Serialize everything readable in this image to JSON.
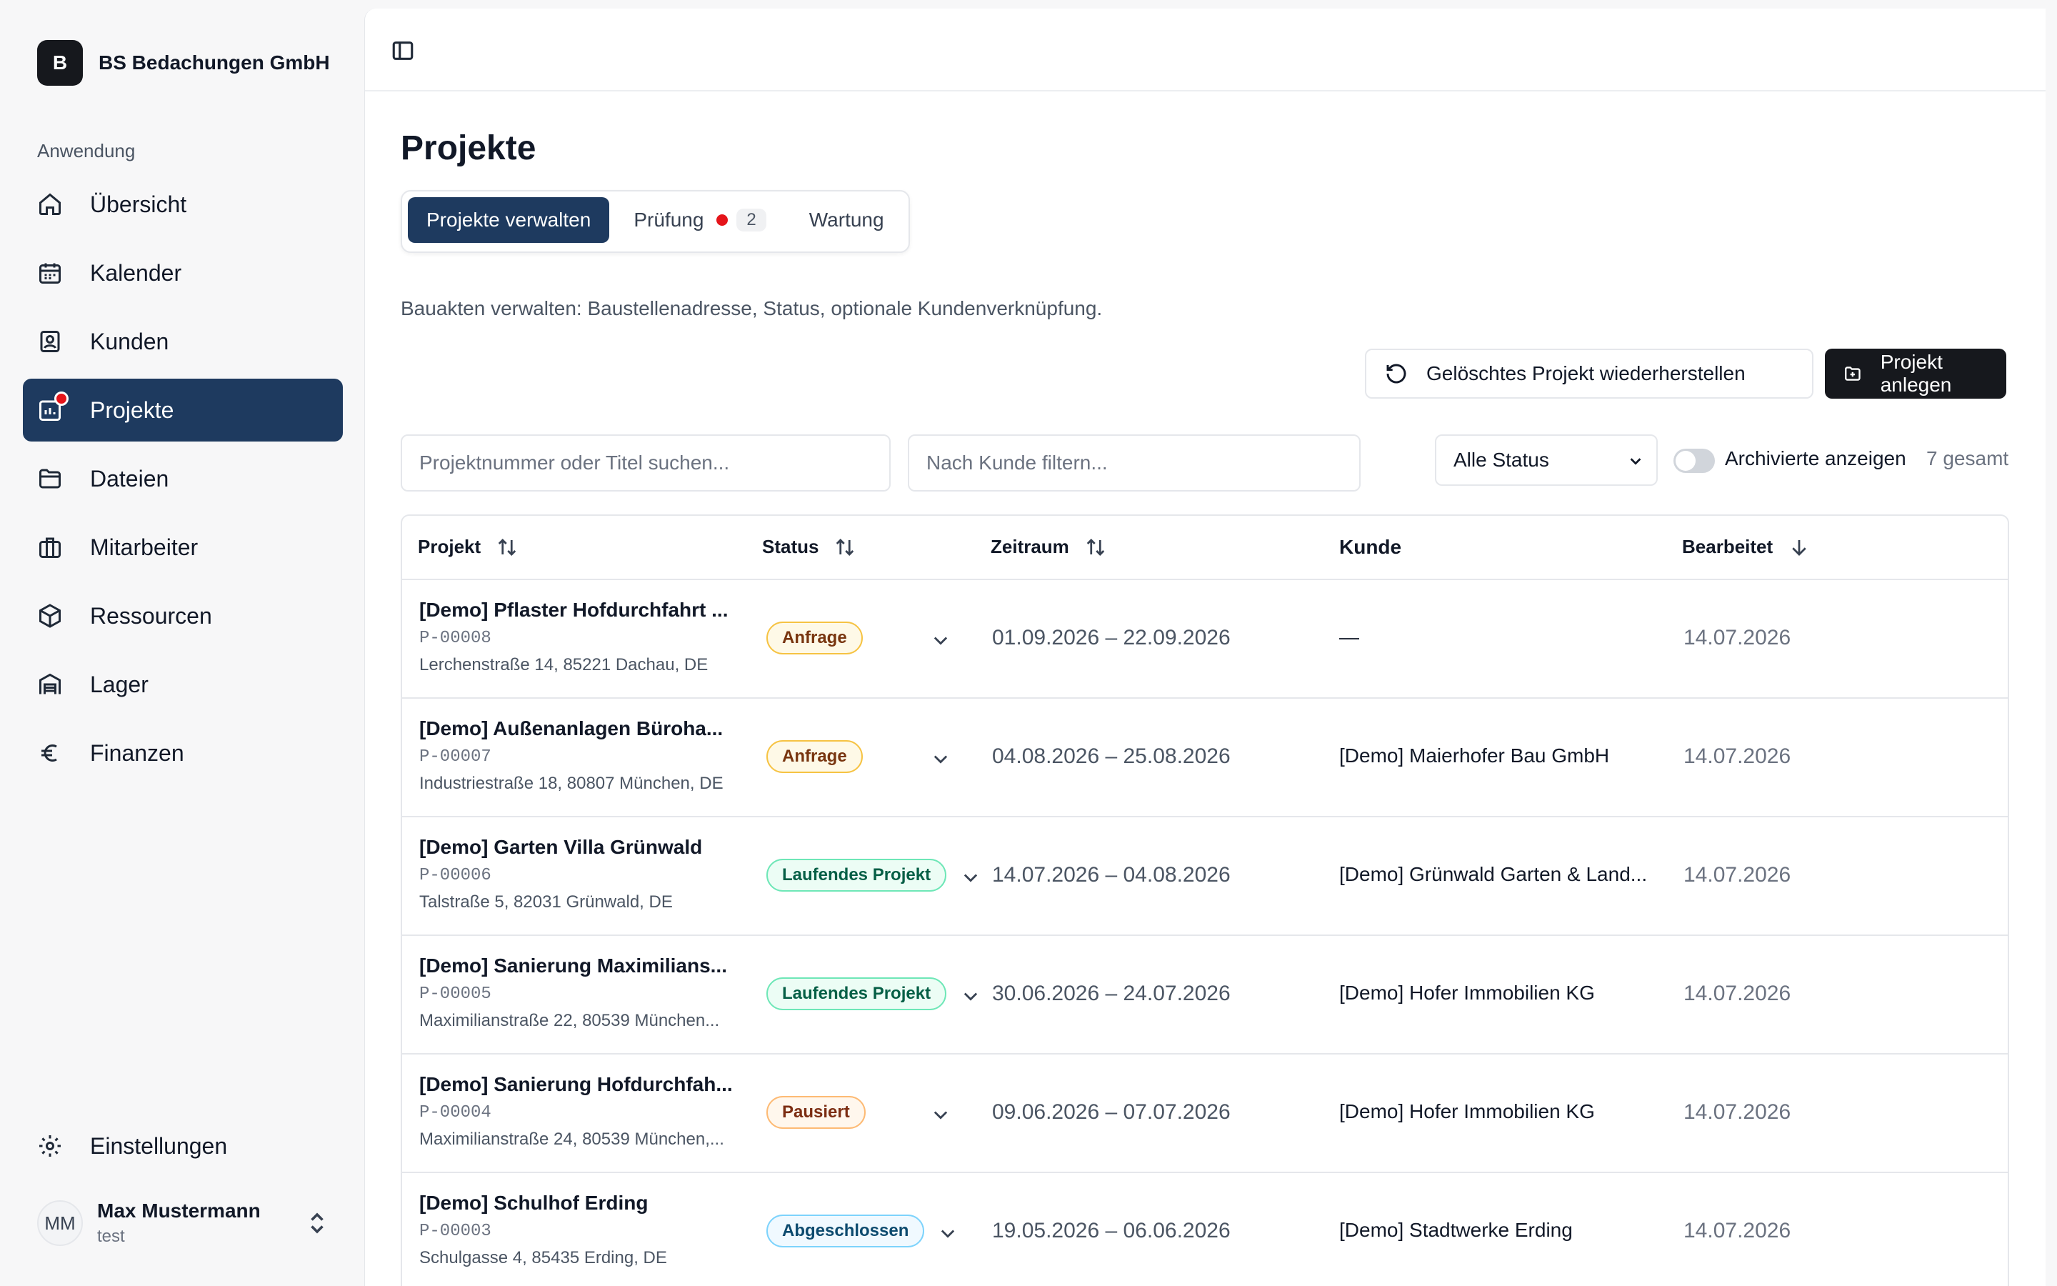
{
  "brand": {
    "logo_letter": "B",
    "name": "BS Bedachungen GmbH"
  },
  "sidebar": {
    "section_label": "Anwendung",
    "items": [
      {
        "label": "Übersicht",
        "icon": "home-icon"
      },
      {
        "label": "Kalender",
        "icon": "calendar-icon"
      },
      {
        "label": "Kunden",
        "icon": "contact-icon"
      },
      {
        "label": "Projekte",
        "icon": "chart-icon",
        "active": true
      },
      {
        "label": "Dateien",
        "icon": "folder-icon"
      },
      {
        "label": "Mitarbeiter",
        "icon": "briefcase-icon"
      },
      {
        "label": "Ressourcen",
        "icon": "box-icon"
      },
      {
        "label": "Lager",
        "icon": "warehouse-icon"
      },
      {
        "label": "Finanzen",
        "icon": "euro-icon"
      }
    ],
    "settings_label": "Einstellungen"
  },
  "user": {
    "initials": "MM",
    "name": "Max Mustermann",
    "sub": "test"
  },
  "page": {
    "title": "Projekte",
    "tabs": [
      {
        "label": "Projekte verwalten",
        "active": true
      },
      {
        "label": "Prüfung",
        "count": "2"
      },
      {
        "label": "Wartung"
      }
    ],
    "subtitle": "Bauakten verwalten: Baustellenadresse, Status, optionale Kundenverknüpfung."
  },
  "toolbar": {
    "restore_label": "Gelöschtes Projekt wiederherstellen",
    "create_label": "Projekt anlegen",
    "search_placeholder": "Projektnummer oder Titel suchen...",
    "customer_placeholder": "Nach Kunde filtern...",
    "status_filter": "Alle Status",
    "archived_label": "Archivierte anzeigen",
    "total": "7 gesamt"
  },
  "table": {
    "headers": {
      "project": "Projekt",
      "status": "Status",
      "period": "Zeitraum",
      "customer": "Kunde",
      "edited": "Bearbeitet"
    },
    "rows": [
      {
        "title": "[Demo] Pflaster Hofdurchfahrt ...",
        "number": "P-00008",
        "address": "Lerchenstraße 14, 85221 Dachau, DE",
        "status": "Anfrage",
        "period": "01.09.2026 – 22.09.2026",
        "customer": "—",
        "edited": "14.07.2026"
      },
      {
        "title": "[Demo] Außenanlagen Büroha...",
        "number": "P-00007",
        "address": "Industriestraße 18, 80807 München, DE",
        "status": "Anfrage",
        "period": "04.08.2026 – 25.08.2026",
        "customer": "[Demo] Maierhofer Bau GmbH",
        "edited": "14.07.2026"
      },
      {
        "title": "[Demo] Garten Villa Grünwald",
        "number": "P-00006",
        "address": "Talstraße 5, 82031 Grünwald, DE",
        "status": "Laufendes Projekt",
        "period": "14.07.2026 – 04.08.2026",
        "customer": "[Demo] Grünwald Garten & Land...",
        "edited": "14.07.2026"
      },
      {
        "title": "[Demo] Sanierung Maximilians...",
        "number": "P-00005",
        "address": "Maximilianstraße 22, 80539 München...",
        "status": "Laufendes Projekt",
        "period": "30.06.2026 – 24.07.2026",
        "customer": "[Demo] Hofer Immobilien KG",
        "edited": "14.07.2026"
      },
      {
        "title": "[Demo] Sanierung Hofdurchfah...",
        "number": "P-00004",
        "address": "Maximilianstraße 24, 80539 München,...",
        "status": "Pausiert",
        "period": "09.06.2026 – 07.07.2026",
        "customer": "[Demo] Hofer Immobilien KG",
        "edited": "14.07.2026"
      },
      {
        "title": "[Demo] Schulhof Erding",
        "number": "P-00003",
        "address": "Schulgasse 4, 85435 Erding, DE",
        "status": "Abgeschlossen",
        "period": "19.05.2026 – 06.06.2026",
        "customer": "[Demo] Stadtwerke Erding",
        "edited": "14.07.2026"
      }
    ]
  },
  "colors": {
    "accent": "#1e3a5f",
    "notification": "#e5141a",
    "status_anfrage": "#d97706",
    "status_laufend": "#059669",
    "status_pausiert": "#ea580c",
    "status_abgeschlossen": "#0284c7"
  }
}
